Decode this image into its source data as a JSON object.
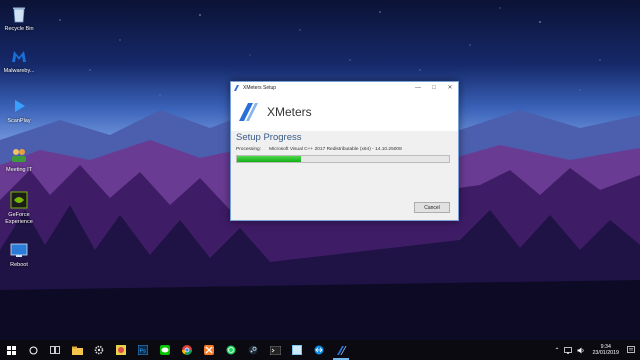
{
  "desktop": {
    "icons": [
      {
        "label": "Recycle Bin",
        "icon": "recycle-bin-icon"
      },
      {
        "label": "Malwareby...",
        "icon": "malwarebytes-icon"
      },
      {
        "label": "ScanPlay",
        "icon": "scanplay-icon"
      },
      {
        "label": "Meeting IT",
        "icon": "meeting-icon"
      },
      {
        "label": "GeForce\nExperience",
        "icon": "geforce-icon"
      },
      {
        "label": "Reboot",
        "icon": "reboot-icon"
      }
    ]
  },
  "window": {
    "title": "XMeters Setup",
    "app_name": "XMeters",
    "progress_title": "Setup Progress",
    "status_label": "Processing:",
    "status_value": "Microsoft Visual C++ 2017 Redistributable (x64) - 14.10.25008",
    "progress_fraction": 0.3,
    "cancel_label": "Cancel"
  },
  "taskbar": {
    "apps": [
      "start-icon",
      "search-icon",
      "task-view-icon",
      "file-explorer-icon",
      "settings-icon",
      "paint-icon",
      "photoshop-icon",
      "line-icon",
      "chrome-icon",
      "xampp-icon",
      "whatsapp-icon",
      "steam-icon",
      "terminal-icon",
      "sticky-notes-icon",
      "teamviewer-icon",
      "setup-icon"
    ],
    "time": "9:34",
    "date": "23/01/2019"
  },
  "colors": {
    "accent": "#76b9ed",
    "progress": "#14b014"
  }
}
